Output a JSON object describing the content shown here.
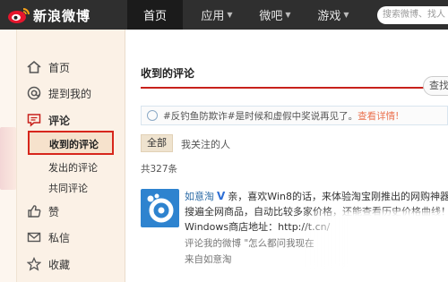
{
  "header": {
    "logo_text": "新浪微博",
    "nav": [
      {
        "label": "首页",
        "active": true
      },
      {
        "label": "应用",
        "has_dropdown": true
      },
      {
        "label": "微吧",
        "has_dropdown": true
      },
      {
        "label": "游戏",
        "has_dropdown": true
      }
    ],
    "search_placeholder": "搜索微博、找人"
  },
  "sidebar": {
    "items": [
      {
        "label": "首页",
        "icon": "home-icon"
      },
      {
        "label": "提到我的",
        "icon": "at-icon"
      },
      {
        "label": "评论",
        "icon": "comment-icon"
      },
      {
        "label": "赞",
        "icon": "thumbs-up-icon"
      },
      {
        "label": "私信",
        "icon": "mail-icon"
      },
      {
        "label": "收藏",
        "icon": "star-icon"
      }
    ],
    "comment_sub": [
      "收到的评论",
      "发出的评论",
      "共同评论"
    ],
    "current": "收到的评论"
  },
  "main": {
    "title": "收到的评论",
    "find_label": "查找",
    "notice": {
      "text": "#反钓鱼防欺诈#是时候和虚假中奖说再见了。",
      "link": "查看详情!"
    },
    "tabs": {
      "all": "全部",
      "following": "我关注的人"
    },
    "count": "共327条",
    "comment": {
      "user": "如意淘",
      "text1": "亲，喜欢Win8的话，来体验淘宝刚推出的网购神器，",
      "text2": "搜遍全网商品，自动比较多家价格，还能查看历史价格曲线！",
      "text3": "Windows商店地址：http://t.cn/",
      "reply_prefix": "评论我的微博",
      "reply_text": "\"怎么都问我现在",
      "source": "来自如意淘"
    }
  },
  "colors": {
    "topbar": "#2f2f2f",
    "accent_red": "#c8211b",
    "link_orange": "#eb7350",
    "user_blue": "#2c6ba6",
    "sidebar_bg": "#fbf1e6"
  }
}
